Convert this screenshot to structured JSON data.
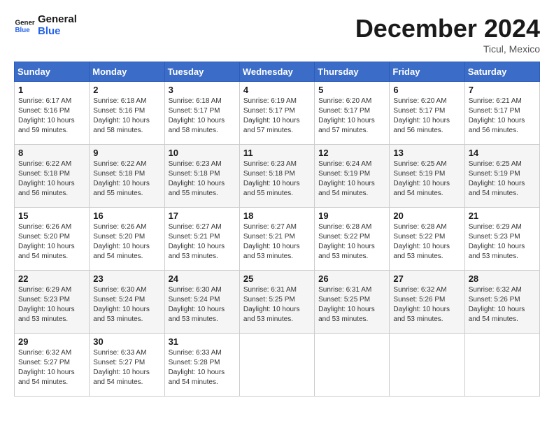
{
  "logo": {
    "line1": "General",
    "line2": "Blue"
  },
  "title": "December 2024",
  "location": "Ticul, Mexico",
  "days_of_week": [
    "Sunday",
    "Monday",
    "Tuesday",
    "Wednesday",
    "Thursday",
    "Friday",
    "Saturday"
  ],
  "weeks": [
    [
      {
        "day": "1",
        "info": "Sunrise: 6:17 AM\nSunset: 5:16 PM\nDaylight: 10 hours\nand 59 minutes."
      },
      {
        "day": "2",
        "info": "Sunrise: 6:18 AM\nSunset: 5:16 PM\nDaylight: 10 hours\nand 58 minutes."
      },
      {
        "day": "3",
        "info": "Sunrise: 6:18 AM\nSunset: 5:17 PM\nDaylight: 10 hours\nand 58 minutes."
      },
      {
        "day": "4",
        "info": "Sunrise: 6:19 AM\nSunset: 5:17 PM\nDaylight: 10 hours\nand 57 minutes."
      },
      {
        "day": "5",
        "info": "Sunrise: 6:20 AM\nSunset: 5:17 PM\nDaylight: 10 hours\nand 57 minutes."
      },
      {
        "day": "6",
        "info": "Sunrise: 6:20 AM\nSunset: 5:17 PM\nDaylight: 10 hours\nand 56 minutes."
      },
      {
        "day": "7",
        "info": "Sunrise: 6:21 AM\nSunset: 5:17 PM\nDaylight: 10 hours\nand 56 minutes."
      }
    ],
    [
      {
        "day": "8",
        "info": "Sunrise: 6:22 AM\nSunset: 5:18 PM\nDaylight: 10 hours\nand 56 minutes."
      },
      {
        "day": "9",
        "info": "Sunrise: 6:22 AM\nSunset: 5:18 PM\nDaylight: 10 hours\nand 55 minutes."
      },
      {
        "day": "10",
        "info": "Sunrise: 6:23 AM\nSunset: 5:18 PM\nDaylight: 10 hours\nand 55 minutes."
      },
      {
        "day": "11",
        "info": "Sunrise: 6:23 AM\nSunset: 5:18 PM\nDaylight: 10 hours\nand 55 minutes."
      },
      {
        "day": "12",
        "info": "Sunrise: 6:24 AM\nSunset: 5:19 PM\nDaylight: 10 hours\nand 54 minutes."
      },
      {
        "day": "13",
        "info": "Sunrise: 6:25 AM\nSunset: 5:19 PM\nDaylight: 10 hours\nand 54 minutes."
      },
      {
        "day": "14",
        "info": "Sunrise: 6:25 AM\nSunset: 5:19 PM\nDaylight: 10 hours\nand 54 minutes."
      }
    ],
    [
      {
        "day": "15",
        "info": "Sunrise: 6:26 AM\nSunset: 5:20 PM\nDaylight: 10 hours\nand 54 minutes."
      },
      {
        "day": "16",
        "info": "Sunrise: 6:26 AM\nSunset: 5:20 PM\nDaylight: 10 hours\nand 54 minutes."
      },
      {
        "day": "17",
        "info": "Sunrise: 6:27 AM\nSunset: 5:21 PM\nDaylight: 10 hours\nand 53 minutes."
      },
      {
        "day": "18",
        "info": "Sunrise: 6:27 AM\nSunset: 5:21 PM\nDaylight: 10 hours\nand 53 minutes."
      },
      {
        "day": "19",
        "info": "Sunrise: 6:28 AM\nSunset: 5:22 PM\nDaylight: 10 hours\nand 53 minutes."
      },
      {
        "day": "20",
        "info": "Sunrise: 6:28 AM\nSunset: 5:22 PM\nDaylight: 10 hours\nand 53 minutes."
      },
      {
        "day": "21",
        "info": "Sunrise: 6:29 AM\nSunset: 5:23 PM\nDaylight: 10 hours\nand 53 minutes."
      }
    ],
    [
      {
        "day": "22",
        "info": "Sunrise: 6:29 AM\nSunset: 5:23 PM\nDaylight: 10 hours\nand 53 minutes."
      },
      {
        "day": "23",
        "info": "Sunrise: 6:30 AM\nSunset: 5:24 PM\nDaylight: 10 hours\nand 53 minutes."
      },
      {
        "day": "24",
        "info": "Sunrise: 6:30 AM\nSunset: 5:24 PM\nDaylight: 10 hours\nand 53 minutes."
      },
      {
        "day": "25",
        "info": "Sunrise: 6:31 AM\nSunset: 5:25 PM\nDaylight: 10 hours\nand 53 minutes."
      },
      {
        "day": "26",
        "info": "Sunrise: 6:31 AM\nSunset: 5:25 PM\nDaylight: 10 hours\nand 53 minutes."
      },
      {
        "day": "27",
        "info": "Sunrise: 6:32 AM\nSunset: 5:26 PM\nDaylight: 10 hours\nand 53 minutes."
      },
      {
        "day": "28",
        "info": "Sunrise: 6:32 AM\nSunset: 5:26 PM\nDaylight: 10 hours\nand 54 minutes."
      }
    ],
    [
      {
        "day": "29",
        "info": "Sunrise: 6:32 AM\nSunset: 5:27 PM\nDaylight: 10 hours\nand 54 minutes."
      },
      {
        "day": "30",
        "info": "Sunrise: 6:33 AM\nSunset: 5:27 PM\nDaylight: 10 hours\nand 54 minutes."
      },
      {
        "day": "31",
        "info": "Sunrise: 6:33 AM\nSunset: 5:28 PM\nDaylight: 10 hours\nand 54 minutes."
      },
      {
        "day": "",
        "info": ""
      },
      {
        "day": "",
        "info": ""
      },
      {
        "day": "",
        "info": ""
      },
      {
        "day": "",
        "info": ""
      }
    ]
  ]
}
